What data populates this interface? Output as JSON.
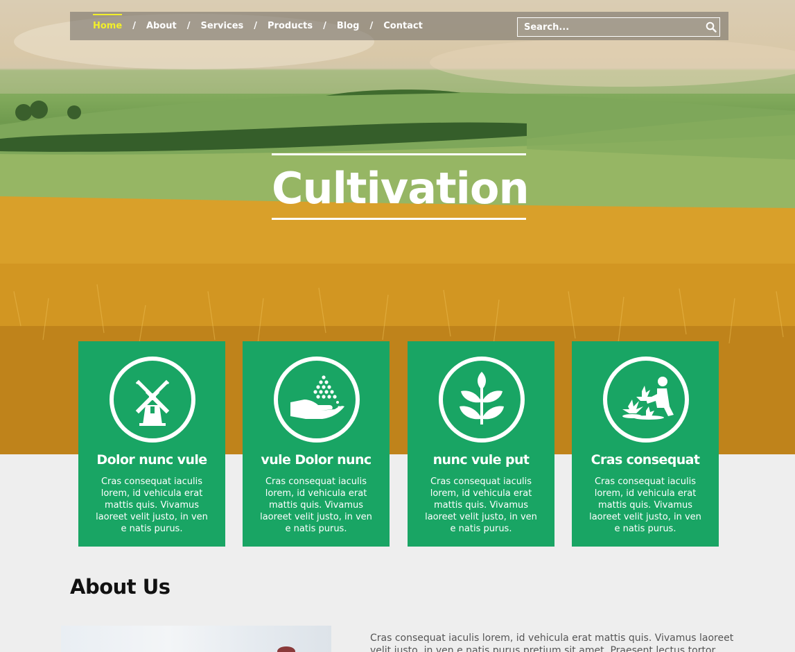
{
  "nav": {
    "items": [
      {
        "label": "Home",
        "active": true
      },
      {
        "label": "About",
        "active": false
      },
      {
        "label": "Services",
        "active": false
      },
      {
        "label": "Products",
        "active": false
      },
      {
        "label": "Blog",
        "active": false
      },
      {
        "label": "Contact",
        "active": false
      }
    ],
    "separator": "/",
    "search_placeholder": "Search...",
    "search_icon": "magnifier-icon"
  },
  "hero": {
    "title": "Cultivation"
  },
  "cards": [
    {
      "icon": "windmill-icon",
      "title": "Dolor nunc vule",
      "text": "Cras consequat iaculis lorem, id vehicula erat mattis quis. Vivamus laoreet velit justo, in ven e natis purus."
    },
    {
      "icon": "hand-seeds-icon",
      "title": "vule Dolor nunc",
      "text": "Cras consequat iaculis lorem, id vehicula erat mattis quis. Vivamus laoreet velit justo, in ven e natis purus."
    },
    {
      "icon": "plant-sprout-icon",
      "title": "nunc vule put",
      "text": "Cras consequat iaculis lorem, id vehicula erat mattis quis. Vivamus laoreet velit justo, in ven e natis purus."
    },
    {
      "icon": "gardener-icon",
      "title": "Cras consequat",
      "text": "Cras consequat iaculis lorem, id vehicula erat mattis quis. Vivamus laoreet velit justo, in ven e natis purus."
    }
  ],
  "about": {
    "heading": "About Us",
    "text": "Cras consequat iaculis lorem, id vehicula erat mattis quis. Vivamus laoreet velit justo, in ven e natis purus pretium sit amet. Praesent lectus tortor, tincidu"
  },
  "colors": {
    "accent_green": "#19a564",
    "active_nav": "#f2ef2a",
    "background": "#eeeeee"
  }
}
